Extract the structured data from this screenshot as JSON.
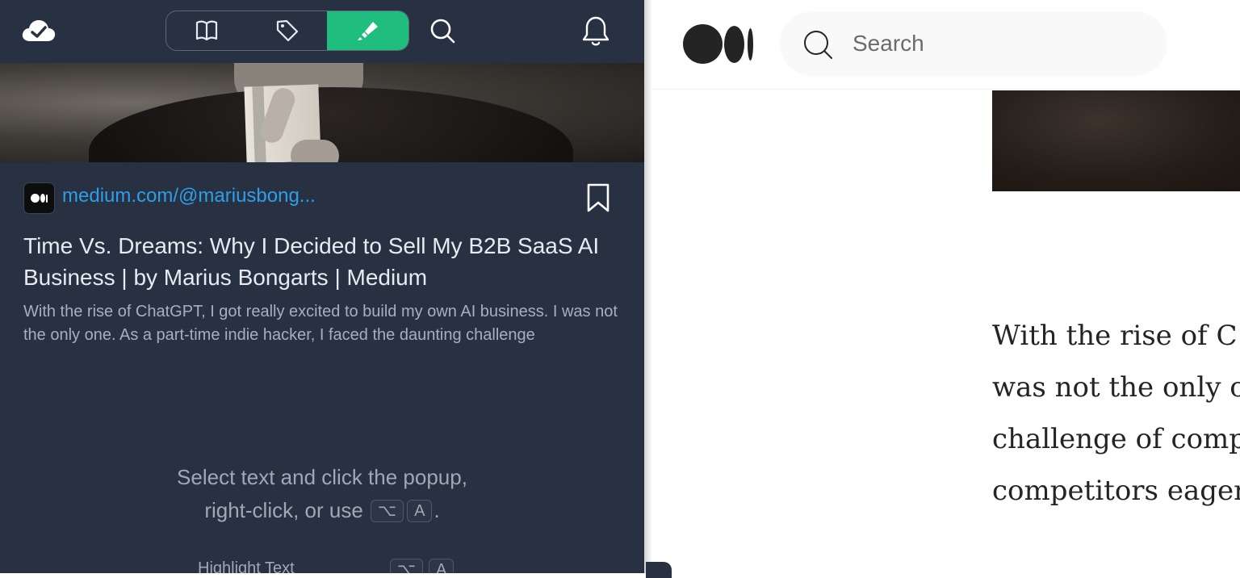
{
  "extension": {
    "toolbar": {
      "icons": [
        "cloud-check-icon",
        "book-icon",
        "tag-icon",
        "highlighter-icon",
        "search-icon",
        "bell-icon"
      ],
      "active_tab": "highlighter",
      "accent_color": "#1fbd7e",
      "background_color": "#273142"
    },
    "item": {
      "site": "medium.com/@mariusbong...",
      "title": "Time Vs. Dreams: Why I Decided to Sell My B2B SaaS AI Business | by Marius Bongarts | Medium",
      "description": "With the rise of ChatGPT, I got really excited to build my own AI business. I was not the only one. As a part-time indie hacker, I faced the daunting challenge"
    },
    "hint": {
      "line1": "Select text and click the popup,",
      "line2_prefix": "right-click, or use",
      "key1": "⌥",
      "key2": "A",
      "line2_suffix": "."
    },
    "shortcut": {
      "label": "Highlight Text",
      "key1": "⌥",
      "key2": "A"
    }
  },
  "medium": {
    "search_placeholder": "Search",
    "article_lines": [
      "With the rise of C",
      "was not the only o",
      "challenge of comp",
      "competitors eager"
    ]
  }
}
